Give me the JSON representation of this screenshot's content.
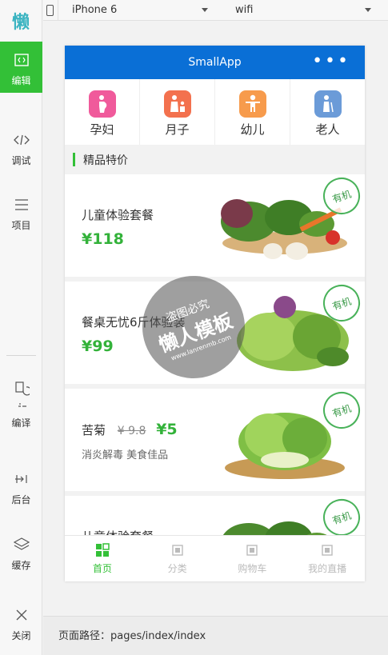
{
  "sidebar": {
    "logo": "懒",
    "items": [
      {
        "label": "编辑",
        "icon": "code-icon"
      },
      {
        "label": "调试",
        "icon": "debug-icon"
      },
      {
        "label": "项目",
        "icon": "menu-icon"
      },
      {
        "label": "编译",
        "icon": "compile-icon"
      },
      {
        "label": "后台",
        "icon": "background-icon"
      },
      {
        "label": "缓存",
        "icon": "layers-icon"
      },
      {
        "label": "关闭",
        "icon": "close-icon"
      }
    ]
  },
  "topbar": {
    "device": "iPhone 6",
    "network": "wifi"
  },
  "phone": {
    "nav_title": "SmallApp",
    "nav_more": "•••",
    "categories": [
      {
        "label": "孕妇",
        "icon": "pregnant-icon",
        "color": "#f05a9b"
      },
      {
        "label": "月子",
        "icon": "mother-child-icon",
        "color": "#f3714e"
      },
      {
        "label": "幼儿",
        "icon": "child-icon",
        "color": "#f79b4c"
      },
      {
        "label": "老人",
        "icon": "elder-icon",
        "color": "#6b9bd8"
      }
    ],
    "section_title": "精品特价",
    "products": [
      {
        "title": "儿童体验套餐",
        "price": "¥118",
        "badge": "有机"
      },
      {
        "title": "餐桌无忧6斤体验装",
        "price": "¥99",
        "badge": "有机"
      },
      {
        "title": "苦菊",
        "old_price": "¥ 9.8",
        "new_price": "¥5",
        "subtitle": "消炎解毒  美食佳品",
        "badge": "有机"
      },
      {
        "title": "儿童体验套餐",
        "badge": "有机"
      }
    ],
    "tabs": [
      {
        "label": "首页",
        "icon": "home-icon"
      },
      {
        "label": "分类",
        "icon": "category-icon"
      },
      {
        "label": "购物车",
        "icon": "cart-icon"
      },
      {
        "label": "我的直播",
        "icon": "live-icon"
      }
    ]
  },
  "watermark": {
    "line1": "盗图必究",
    "line2": "懒人模板",
    "line3": "www.lanrenmb.com"
  },
  "footer": {
    "path_label": "页面路径：",
    "path": "pages/index/index"
  },
  "colors": {
    "accent": "#33c037",
    "nav_bg": "#0a6fd6",
    "price": "#33b23a"
  }
}
